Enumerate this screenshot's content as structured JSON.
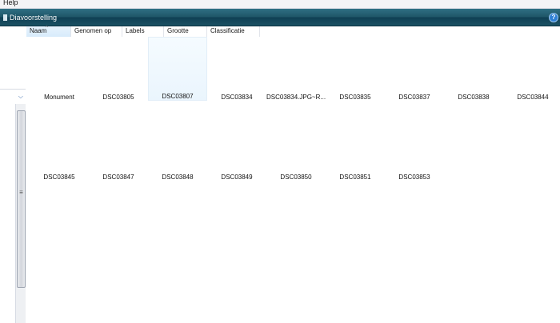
{
  "menubar": {
    "help_label": "Help"
  },
  "toolbar": {
    "slideshow_label": "Diavoorstelling",
    "help_icon": "?"
  },
  "columns": {
    "name": "Naam",
    "taken": "Genomen op",
    "labels": "Labels",
    "size": "Grootte",
    "rating": "Classificatie"
  },
  "files": {
    "row1": [
      "Monument",
      "DSC03805",
      "DSC03807",
      "DSC03834",
      "DSC03834.JPG~R...",
      "DSC03835",
      "DSC03837",
      "DSC03838",
      "DSC03844"
    ],
    "row2": [
      "DSC03845",
      "DSC03847",
      "DSC03848",
      "DSC03849",
      "DSC03850",
      "DSC03851",
      "DSC03853"
    ]
  },
  "selected_file": "DSC03807"
}
